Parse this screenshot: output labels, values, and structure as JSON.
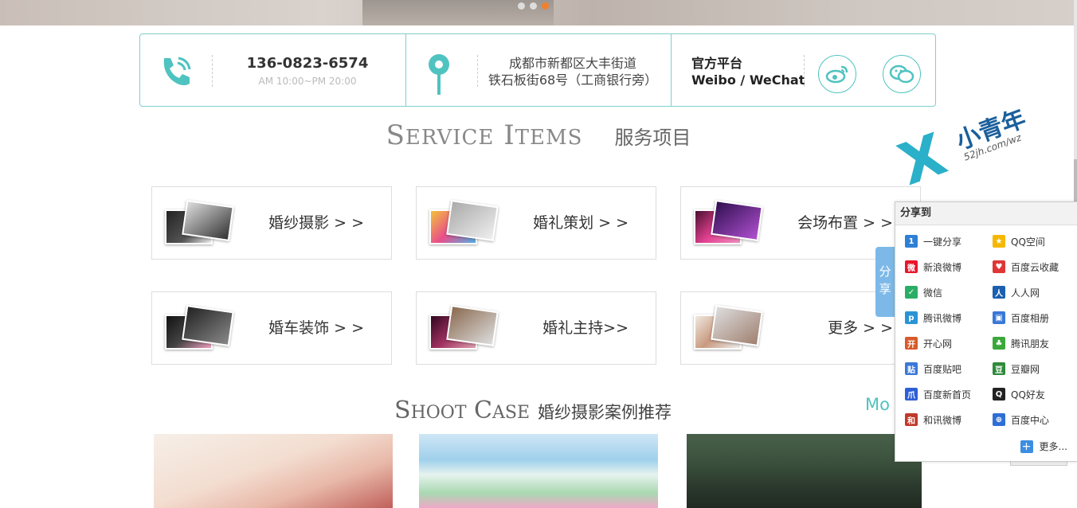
{
  "contact": {
    "phone": "136-0823-6574",
    "hours": "AM 10:00~PM 20:00",
    "address_line1": "成都市新都区大丰街道",
    "address_line2": "铁石板街68号（工商银行旁）",
    "social_title": "官方平台",
    "social_sub": "Weibo / WeChat"
  },
  "service": {
    "en_first": "S",
    "en_rest1": "ERVICE",
    "en_second": "I",
    "en_rest2": "TEMS",
    "cn": "服务项目",
    "items": [
      {
        "label": "婚纱摄影 > >"
      },
      {
        "label": "婚礼策划 > >"
      },
      {
        "label": "会场布置 > >"
      },
      {
        "label": "婚车装饰 > >"
      },
      {
        "label": "婚礼主持>>"
      },
      {
        "label": "更多 > >"
      }
    ]
  },
  "cases": {
    "en_first": "S",
    "en_rest1": "HOOT",
    "en_second": "C",
    "en_rest2": "ASE",
    "cn": "婚纱摄影案例推荐",
    "more": "Mo"
  },
  "watermark": {
    "cn": "小青年",
    "url": "52jh.com/wz"
  },
  "share": {
    "tab": "分享",
    "title": "分享到",
    "items": [
      {
        "label": "一键分享",
        "icon": "one-click-share-icon",
        "color": "#2e7fd6"
      },
      {
        "label": "QQ空间",
        "icon": "qzone-icon",
        "color": "#f5b800"
      },
      {
        "label": "新浪微博",
        "icon": "sina-weibo-icon",
        "color": "#e6162d"
      },
      {
        "label": "百度云收藏",
        "icon": "heart-icon",
        "color": "#e03636"
      },
      {
        "label": "微信",
        "icon": "wechat-icon",
        "color": "#2aae67"
      },
      {
        "label": "人人网",
        "icon": "renren-icon",
        "color": "#1b5fb0"
      },
      {
        "label": "腾讯微博",
        "icon": "tencent-weibo-icon",
        "color": "#2a94d6"
      },
      {
        "label": "百度相册",
        "icon": "baidu-album-icon",
        "color": "#3a78d8"
      },
      {
        "label": "开心网",
        "icon": "kaixin-icon",
        "color": "#d85a2b"
      },
      {
        "label": "腾讯朋友",
        "icon": "clover-icon",
        "color": "#3aa83a"
      },
      {
        "label": "百度贴吧",
        "icon": "tieba-icon",
        "color": "#3a78d8"
      },
      {
        "label": "豆瓣网",
        "icon": "douban-icon",
        "color": "#2f8a3a"
      },
      {
        "label": "百度新首页",
        "icon": "baidu-paw-icon",
        "color": "#2e5fd6"
      },
      {
        "label": "QQ好友",
        "icon": "qq-penguin-icon",
        "color": "#222222"
      },
      {
        "label": "和讯微博",
        "icon": "hexun-icon",
        "color": "#c0392b"
      },
      {
        "label": "百度中心",
        "icon": "baidu-center-icon",
        "color": "#2e6fd6"
      }
    ],
    "more": "更多..."
  },
  "colors": {
    "accent": "#4fc3c0",
    "share_tab": "#7db9e8"
  }
}
